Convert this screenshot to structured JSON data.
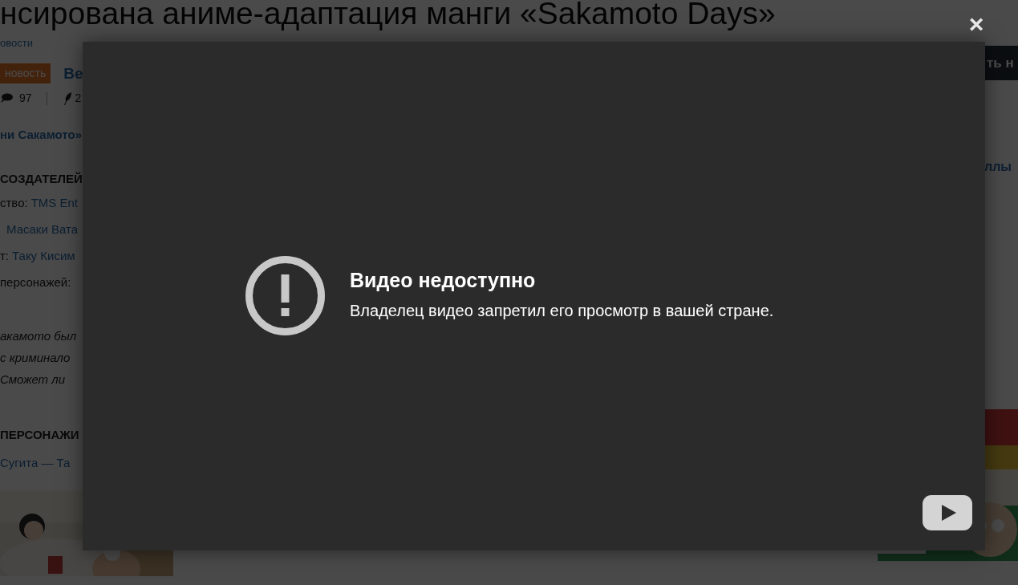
{
  "article": {
    "title": "нсирована аниме-адаптация манги «Sakamoto Days»",
    "breadcrumb": "овости",
    "badge": "новость",
    "headline_link": "Ве",
    "comments": "97",
    "likes": "2",
    "subtitle_link": "ни Сакамото»",
    "creators": {
      "heading": "СОЗДАТЕЛЕЙ",
      "lines": [
        {
          "label": "ство: ",
          "link": "TMS Ent"
        },
        {
          "link": "Масаки Вата"
        },
        {
          "label": "т: ",
          "link": "Таку Кисим"
        },
        {
          "label": "персонажей:"
        }
      ]
    },
    "synopsis": [
      "акамото был",
      "с криминало",
      "Сможет ли"
    ],
    "characters": {
      "heading": "ПЕРСОНАЖИ",
      "line": "Сугита — Та"
    }
  },
  "sidebar": {
    "button": "ть н",
    "link": "ллы"
  },
  "video_modal": {
    "close": "×",
    "title": "Видео недоступно",
    "message": "Владелец видео запретил его просмотр в вашей стране."
  }
}
